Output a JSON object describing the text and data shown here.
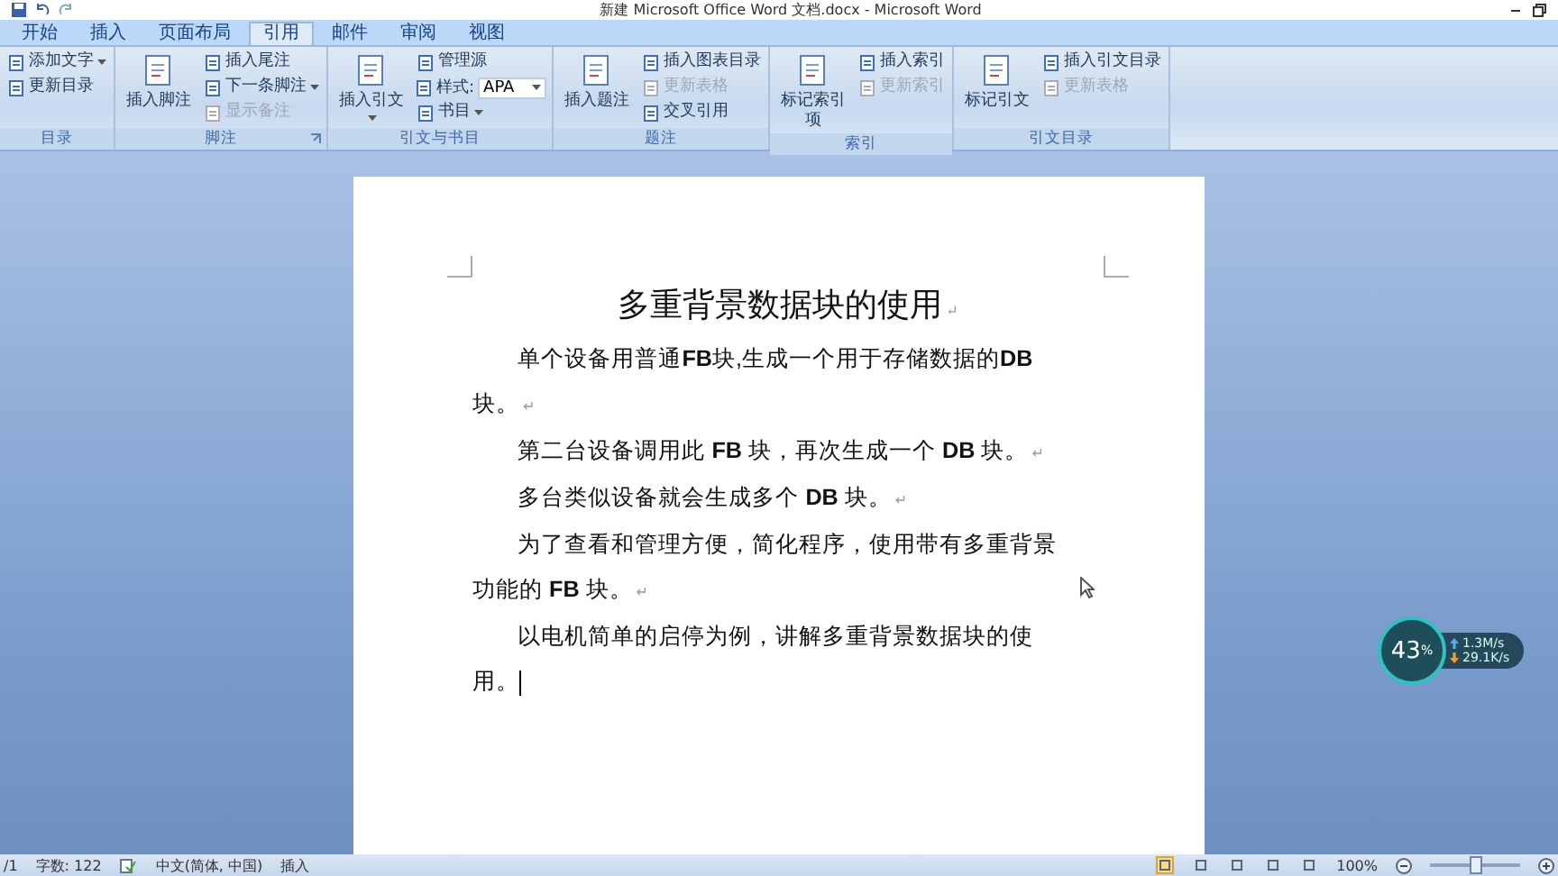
{
  "window": {
    "title": "新建 Microsoft Office Word 文档.docx - Microsoft Word"
  },
  "tabs": [
    {
      "label": "开始",
      "selected": false
    },
    {
      "label": "插入",
      "selected": false
    },
    {
      "label": "页面布局",
      "selected": false
    },
    {
      "label": "引用",
      "selected": true
    },
    {
      "label": "邮件",
      "selected": false
    },
    {
      "label": "审阅",
      "selected": false
    },
    {
      "label": "视图",
      "selected": false
    }
  ],
  "ribbon_groups": [
    {
      "label": "目录",
      "launcher": false,
      "columns": [
        [
          {
            "kind": "small",
            "label": "添加文字",
            "dropdown": true,
            "disabled": false
          },
          {
            "kind": "small",
            "label": "更新目录",
            "dropdown": false,
            "disabled": false
          }
        ]
      ]
    },
    {
      "label": "脚注",
      "launcher": true,
      "columns": [
        [
          {
            "kind": "large",
            "label": "插入脚注",
            "dropdown": false
          }
        ],
        [
          {
            "kind": "small",
            "label": "插入尾注",
            "dropdown": false,
            "disabled": false
          },
          {
            "kind": "small",
            "label": "下一条脚注",
            "dropdown": true,
            "disabled": false
          },
          {
            "kind": "small",
            "label": "显示备注",
            "dropdown": false,
            "disabled": true
          }
        ]
      ]
    },
    {
      "label": "引文与书目",
      "launcher": false,
      "columns": [
        [
          {
            "kind": "large",
            "label": "插入引文",
            "dropdown": true
          }
        ],
        [
          {
            "kind": "small",
            "label": "管理源",
            "dropdown": false,
            "disabled": false
          },
          {
            "kind": "select",
            "label": "样式:",
            "value": "APA"
          },
          {
            "kind": "small",
            "label": "书目",
            "dropdown": true,
            "disabled": false
          }
        ]
      ]
    },
    {
      "label": "题注",
      "launcher": false,
      "columns": [
        [
          {
            "kind": "large",
            "label": "插入题注",
            "dropdown": false
          }
        ],
        [
          {
            "kind": "small",
            "label": "插入图表目录",
            "dropdown": false,
            "disabled": false
          },
          {
            "kind": "small",
            "label": "更新表格",
            "dropdown": false,
            "disabled": true
          },
          {
            "kind": "small",
            "label": "交叉引用",
            "dropdown": false,
            "disabled": false
          }
        ]
      ]
    },
    {
      "label": "索引",
      "launcher": false,
      "columns": [
        [
          {
            "kind": "large",
            "label": "标记索引项",
            "dropdown": false
          }
        ],
        [
          {
            "kind": "small",
            "label": "插入索引",
            "dropdown": false,
            "disabled": false
          },
          {
            "kind": "small",
            "label": "更新索引",
            "dropdown": false,
            "disabled": true
          }
        ]
      ]
    },
    {
      "label": "引文目录",
      "launcher": false,
      "columns": [
        [
          {
            "kind": "large",
            "label": "标记引文",
            "dropdown": false
          }
        ],
        [
          {
            "kind": "small",
            "label": "插入引文目录",
            "dropdown": false,
            "disabled": false
          },
          {
            "kind": "small",
            "label": "更新表格",
            "dropdown": false,
            "disabled": true
          }
        ]
      ]
    }
  ],
  "document": {
    "title": {
      "text": "多重背景数据块的使用",
      "mark": "↵"
    },
    "paragraphs": [
      {
        "text": "单个设备用普通**FB**块,生成一个用于存储数据的**DB**块。",
        "mark": "↵",
        "cursor": false
      },
      {
        "text": "第二台设备调用此 **FB** 块，再次生成一个 **DB** 块。",
        "mark": "↵",
        "cursor": false
      },
      {
        "text": "多台类似设备就会生成多个 **DB** 块。",
        "mark": "↵",
        "cursor": false
      },
      {
        "text": "为了查看和管理方便，简化程序，使用带有多重背景功能的 **FB** 块。",
        "mark": "↵",
        "cursor": false
      },
      {
        "text": "以电机简单的启停为例，讲解多重背景数据块的使用。",
        "cursor": true
      }
    ]
  },
  "network_widget": {
    "percent": "43",
    "unit": "%",
    "upload": "1.3M/s",
    "download": "29.1K/s"
  },
  "status_bar": {
    "page": "/1",
    "word_count": "字数: 122",
    "language": "中文(简体, 中国)",
    "mode": "插入",
    "views": [
      {
        "selected": true
      },
      {
        "selected": false
      },
      {
        "selected": false
      },
      {
        "selected": false
      },
      {
        "selected": false
      }
    ],
    "zoom": "100%",
    "zoom_slider": {
      "level": 0.5
    }
  }
}
